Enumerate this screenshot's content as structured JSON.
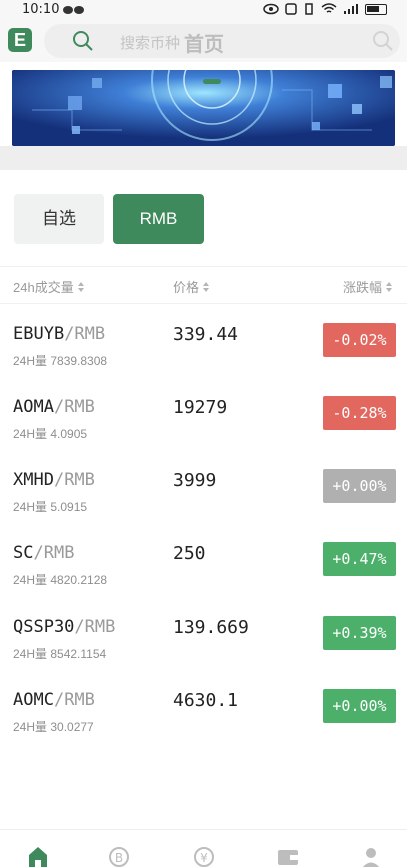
{
  "status": {
    "time": "10:10"
  },
  "header": {
    "search_placeholder": "搜索币种",
    "title": "首页"
  },
  "tabs": [
    {
      "label": "自选",
      "active": false
    },
    {
      "label": "RMB",
      "active": true
    }
  ],
  "columns": {
    "volume": "24h成交量",
    "price": "价格",
    "change": "涨跌幅"
  },
  "markets": [
    {
      "base": "EBUYB",
      "quote": "/RMB",
      "volume": "24H量 7839.8308",
      "price": "339.44",
      "change": "-0.02%",
      "trend": "down"
    },
    {
      "base": "AOMA",
      "quote": "/RMB",
      "volume": "24H量 4.0905",
      "price": "19279",
      "change": "-0.28%",
      "trend": "down"
    },
    {
      "base": "XMHD",
      "quote": "/RMB",
      "volume": "24H量 5.0915",
      "price": "3999",
      "change": "+0.00%",
      "trend": "flat"
    },
    {
      "base": "SC",
      "quote": "/RMB",
      "volume": "24H量 4820.2128",
      "price": "250",
      "change": "+0.47%",
      "trend": "up"
    },
    {
      "base": "QSSP30",
      "quote": "/RMB",
      "volume": "24H量 8542.1154",
      "price": "139.669",
      "change": "+0.39%",
      "trend": "up"
    },
    {
      "base": "AOMC",
      "quote": "/RMB",
      "volume": "24H量 30.0277",
      "price": "4630.1",
      "change": "+0.00%",
      "trend": "up"
    }
  ],
  "colors": {
    "accent": "#3f8a5c",
    "down": "#e2675f",
    "up": "#4caf6a",
    "flat": "#b0b0b0"
  },
  "bottom_nav": [
    {
      "icon": "home-icon",
      "active": true
    },
    {
      "icon": "bitcoin-icon",
      "active": false
    },
    {
      "icon": "yuan-exchange-icon",
      "active": false
    },
    {
      "icon": "wallet-icon",
      "active": false
    },
    {
      "icon": "user-icon",
      "active": false
    }
  ]
}
